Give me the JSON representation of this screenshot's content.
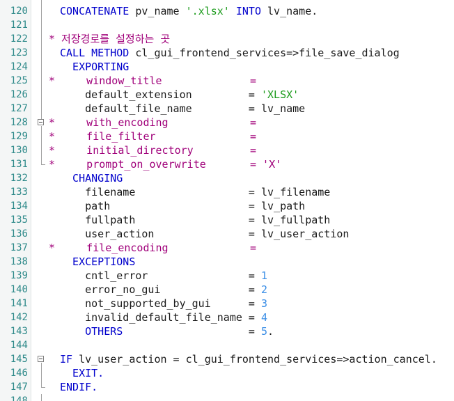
{
  "editor": {
    "lines": [
      {
        "n": "120",
        "segs": [
          {
            "t": "CONCATENATE ",
            "c": "kw"
          },
          {
            "t": "pv_name ",
            "c": ""
          },
          {
            "t": "'.xlsx'",
            "c": "str"
          },
          {
            "t": " ",
            "c": ""
          },
          {
            "t": "INTO",
            "c": "kw"
          },
          {
            "t": " lv_name.",
            "c": ""
          }
        ]
      },
      {
        "n": "121",
        "segs": []
      },
      {
        "n": "122",
        "segs": [
          {
            "t": "* 저장경로를 설정하는 곳",
            "c": "cm",
            "pre": "-1"
          }
        ]
      },
      {
        "n": "123",
        "segs": [
          {
            "t": "CALL METHOD ",
            "c": "kw"
          },
          {
            "t": "cl_gui_frontend_services=>file_save_dialog",
            "c": ""
          }
        ]
      },
      {
        "n": "124",
        "segs": [
          {
            "t": "  EXPORTING",
            "c": "kw"
          }
        ]
      },
      {
        "n": "125",
        "segs": [
          {
            "t": "*     window_title              =",
            "c": "cm",
            "pre": "-1"
          }
        ]
      },
      {
        "n": "126",
        "segs": [
          {
            "t": "    default_extension         = ",
            "c": ""
          },
          {
            "t": "'XLSX'",
            "c": "str"
          }
        ]
      },
      {
        "n": "127",
        "segs": [
          {
            "t": "    default_file_name         = lv_name",
            "c": ""
          }
        ]
      },
      {
        "n": "128",
        "segs": [
          {
            "t": "*     with_encoding             =",
            "c": "cm",
            "pre": "-1"
          }
        ]
      },
      {
        "n": "129",
        "segs": [
          {
            "t": "*     file_filter               =",
            "c": "cm",
            "pre": "-1"
          }
        ]
      },
      {
        "n": "130",
        "segs": [
          {
            "t": "*     initial_directory         =",
            "c": "cm",
            "pre": "-1"
          }
        ]
      },
      {
        "n": "131",
        "segs": [
          {
            "t": "*     prompt_on_overwrite       = ",
            "c": "cm",
            "pre": "-1"
          },
          {
            "t": "'X'",
            "c": "cm"
          }
        ]
      },
      {
        "n": "132",
        "segs": [
          {
            "t": "  CHANGING",
            "c": "kw"
          }
        ]
      },
      {
        "n": "133",
        "segs": [
          {
            "t": "    filename                  = lv_filename",
            "c": ""
          }
        ]
      },
      {
        "n": "134",
        "segs": [
          {
            "t": "    path                      = lv_path",
            "c": ""
          }
        ]
      },
      {
        "n": "135",
        "segs": [
          {
            "t": "    fullpath                  = lv_fullpath",
            "c": ""
          }
        ]
      },
      {
        "n": "136",
        "segs": [
          {
            "t": "    user_action               = lv_user_action",
            "c": ""
          }
        ]
      },
      {
        "n": "137",
        "segs": [
          {
            "t": "*     file_encoding             =",
            "c": "cm",
            "pre": "-1"
          }
        ]
      },
      {
        "n": "138",
        "segs": [
          {
            "t": "  EXCEPTIONS",
            "c": "kw"
          }
        ]
      },
      {
        "n": "139",
        "segs": [
          {
            "t": "    cntl_error                = ",
            "c": ""
          },
          {
            "t": "1",
            "c": "num"
          }
        ]
      },
      {
        "n": "140",
        "segs": [
          {
            "t": "    error_no_gui              = ",
            "c": ""
          },
          {
            "t": "2",
            "c": "num"
          }
        ]
      },
      {
        "n": "141",
        "segs": [
          {
            "t": "    not_supported_by_gui      = ",
            "c": ""
          },
          {
            "t": "3",
            "c": "num"
          }
        ]
      },
      {
        "n": "142",
        "segs": [
          {
            "t": "    invalid_default_file_name = ",
            "c": ""
          },
          {
            "t": "4",
            "c": "num"
          }
        ]
      },
      {
        "n": "143",
        "segs": [
          {
            "t": "    OTHERS",
            "c": "kw"
          },
          {
            "t": "                    = ",
            "c": ""
          },
          {
            "t": "5",
            "c": "num"
          },
          {
            "t": ".",
            "c": ""
          }
        ]
      },
      {
        "n": "144",
        "segs": []
      },
      {
        "n": "145",
        "segs": [
          {
            "t": "IF ",
            "c": "kw"
          },
          {
            "t": "lv_user_action = cl_gui_frontend_services=>action_cancel.",
            "c": ""
          }
        ]
      },
      {
        "n": "146",
        "segs": [
          {
            "t": "  EXIT.",
            "c": "kw"
          }
        ]
      },
      {
        "n": "147",
        "segs": [
          {
            "t": "ENDIF.",
            "c": "kw"
          }
        ]
      },
      {
        "n": "148",
        "segs": []
      }
    ]
  }
}
